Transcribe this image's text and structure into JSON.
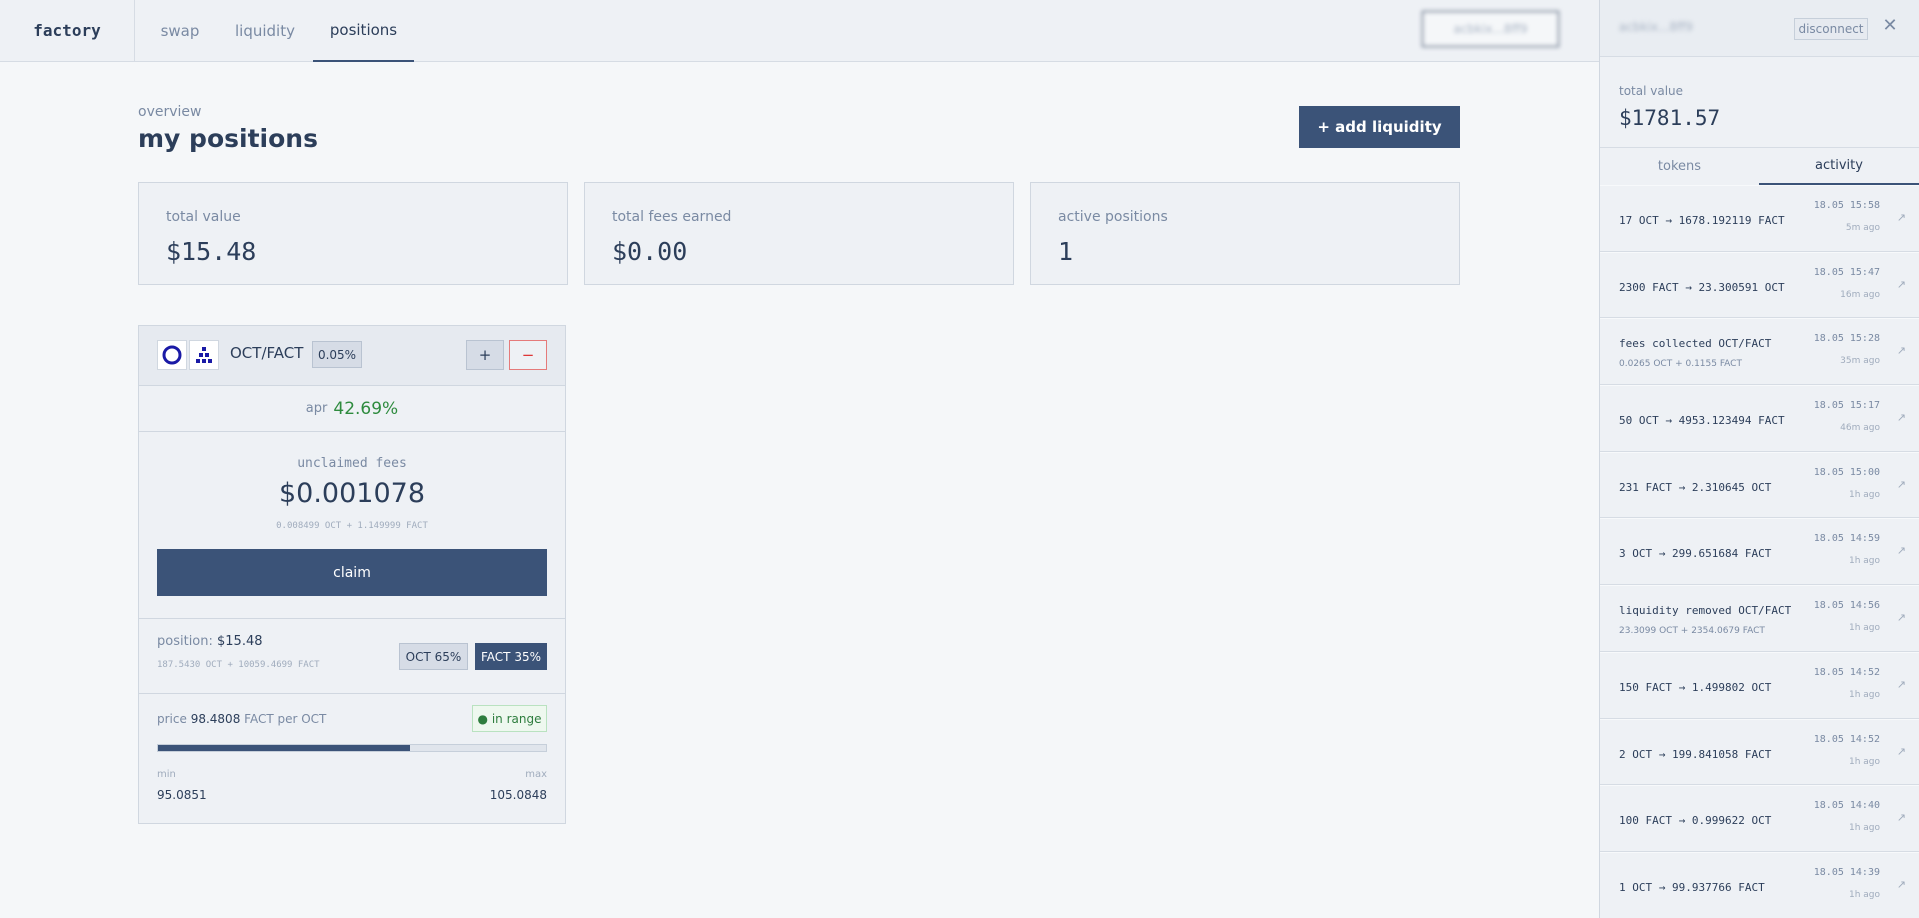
{
  "nav": {
    "logo": "factory",
    "tabs": [
      {
        "label": "swap"
      },
      {
        "label": "liquidity"
      },
      {
        "label": "positions"
      }
    ],
    "wallet_label": "acbkix...8ff9"
  },
  "main": {
    "overview_label": "overview",
    "title": "my positions",
    "add_liquidity_label": "+ add liquidity",
    "stats": [
      {
        "label": "total value",
        "value": "$15.48"
      },
      {
        "label": "total fees earned",
        "value": "$0.00"
      },
      {
        "label": "active positions",
        "value": "1"
      }
    ]
  },
  "position": {
    "icons": [
      "oct-token-icon",
      "fact-token-icon"
    ],
    "pair": "OCT/FACT",
    "fee_tier": "0.05%",
    "plus_label": "+",
    "minus_label": "−",
    "apr_label": "apr",
    "apr_value": "42.69%",
    "fees_label": "unclaimed fees",
    "fees_value": "$0.001078",
    "fees_breakdown": "0.008499 OCT + 1.149999 FACT",
    "claim_label": "claim",
    "position_label": "position:",
    "position_value": "$15.48",
    "position_breakdown": "187.5430 OCT + 10059.4699 FACT",
    "oct_pct_label": "OCT 65%",
    "fact_pct_label": "FACT 35%",
    "price_label": "price",
    "price_value": "98.4808",
    "price_unit": "FACT per OCT",
    "range_label": "● in range",
    "range_fill_pct": 65,
    "min_label": "min",
    "max_label": "max",
    "min_value": "95.0851",
    "max_value": "105.0848"
  },
  "panel": {
    "address": "acbkix...8ff9",
    "disconnect_label": "disconnect",
    "close_label": "✕",
    "total_value_label": "total value",
    "total_value": "$1781.57",
    "tabs": [
      {
        "label": "tokens"
      },
      {
        "label": "activity"
      }
    ],
    "activity": [
      {
        "title": "17 OCT → 1678.192119 FACT",
        "sub": "",
        "time": "18.05 15:58",
        "ago": "5m ago"
      },
      {
        "title": "2300 FACT → 23.300591 OCT",
        "sub": "",
        "time": "18.05 15:47",
        "ago": "16m ago"
      },
      {
        "title": "fees collected OCT/FACT",
        "sub": "0.0265 OCT + 0.1155 FACT",
        "time": "18.05 15:28",
        "ago": "35m ago"
      },
      {
        "title": "50 OCT → 4953.123494 FACT",
        "sub": "",
        "time": "18.05 15:17",
        "ago": "46m ago"
      },
      {
        "title": "231 FACT → 2.310645 OCT",
        "sub": "",
        "time": "18.05 15:00",
        "ago": "1h ago"
      },
      {
        "title": "3 OCT → 299.651684 FACT",
        "sub": "",
        "time": "18.05 14:59",
        "ago": "1h ago"
      },
      {
        "title": "liquidity removed OCT/FACT",
        "sub": "23.3099 OCT + 2354.0679 FACT",
        "time": "18.05 14:56",
        "ago": "1h ago"
      },
      {
        "title": "150 FACT → 1.499802 OCT",
        "sub": "",
        "time": "18.05 14:52",
        "ago": "1h ago"
      },
      {
        "title": "2 OCT → 199.841058 FACT",
        "sub": "",
        "time": "18.05 14:52",
        "ago": "1h ago"
      },
      {
        "title": "100 FACT → 0.999622 OCT",
        "sub": "",
        "time": "18.05 14:40",
        "ago": "1h ago"
      },
      {
        "title": "1 OCT → 99.937766 FACT",
        "sub": "",
        "time": "18.05 14:39",
        "ago": "1h ago"
      }
    ],
    "link_icon": "external-link-icon"
  }
}
